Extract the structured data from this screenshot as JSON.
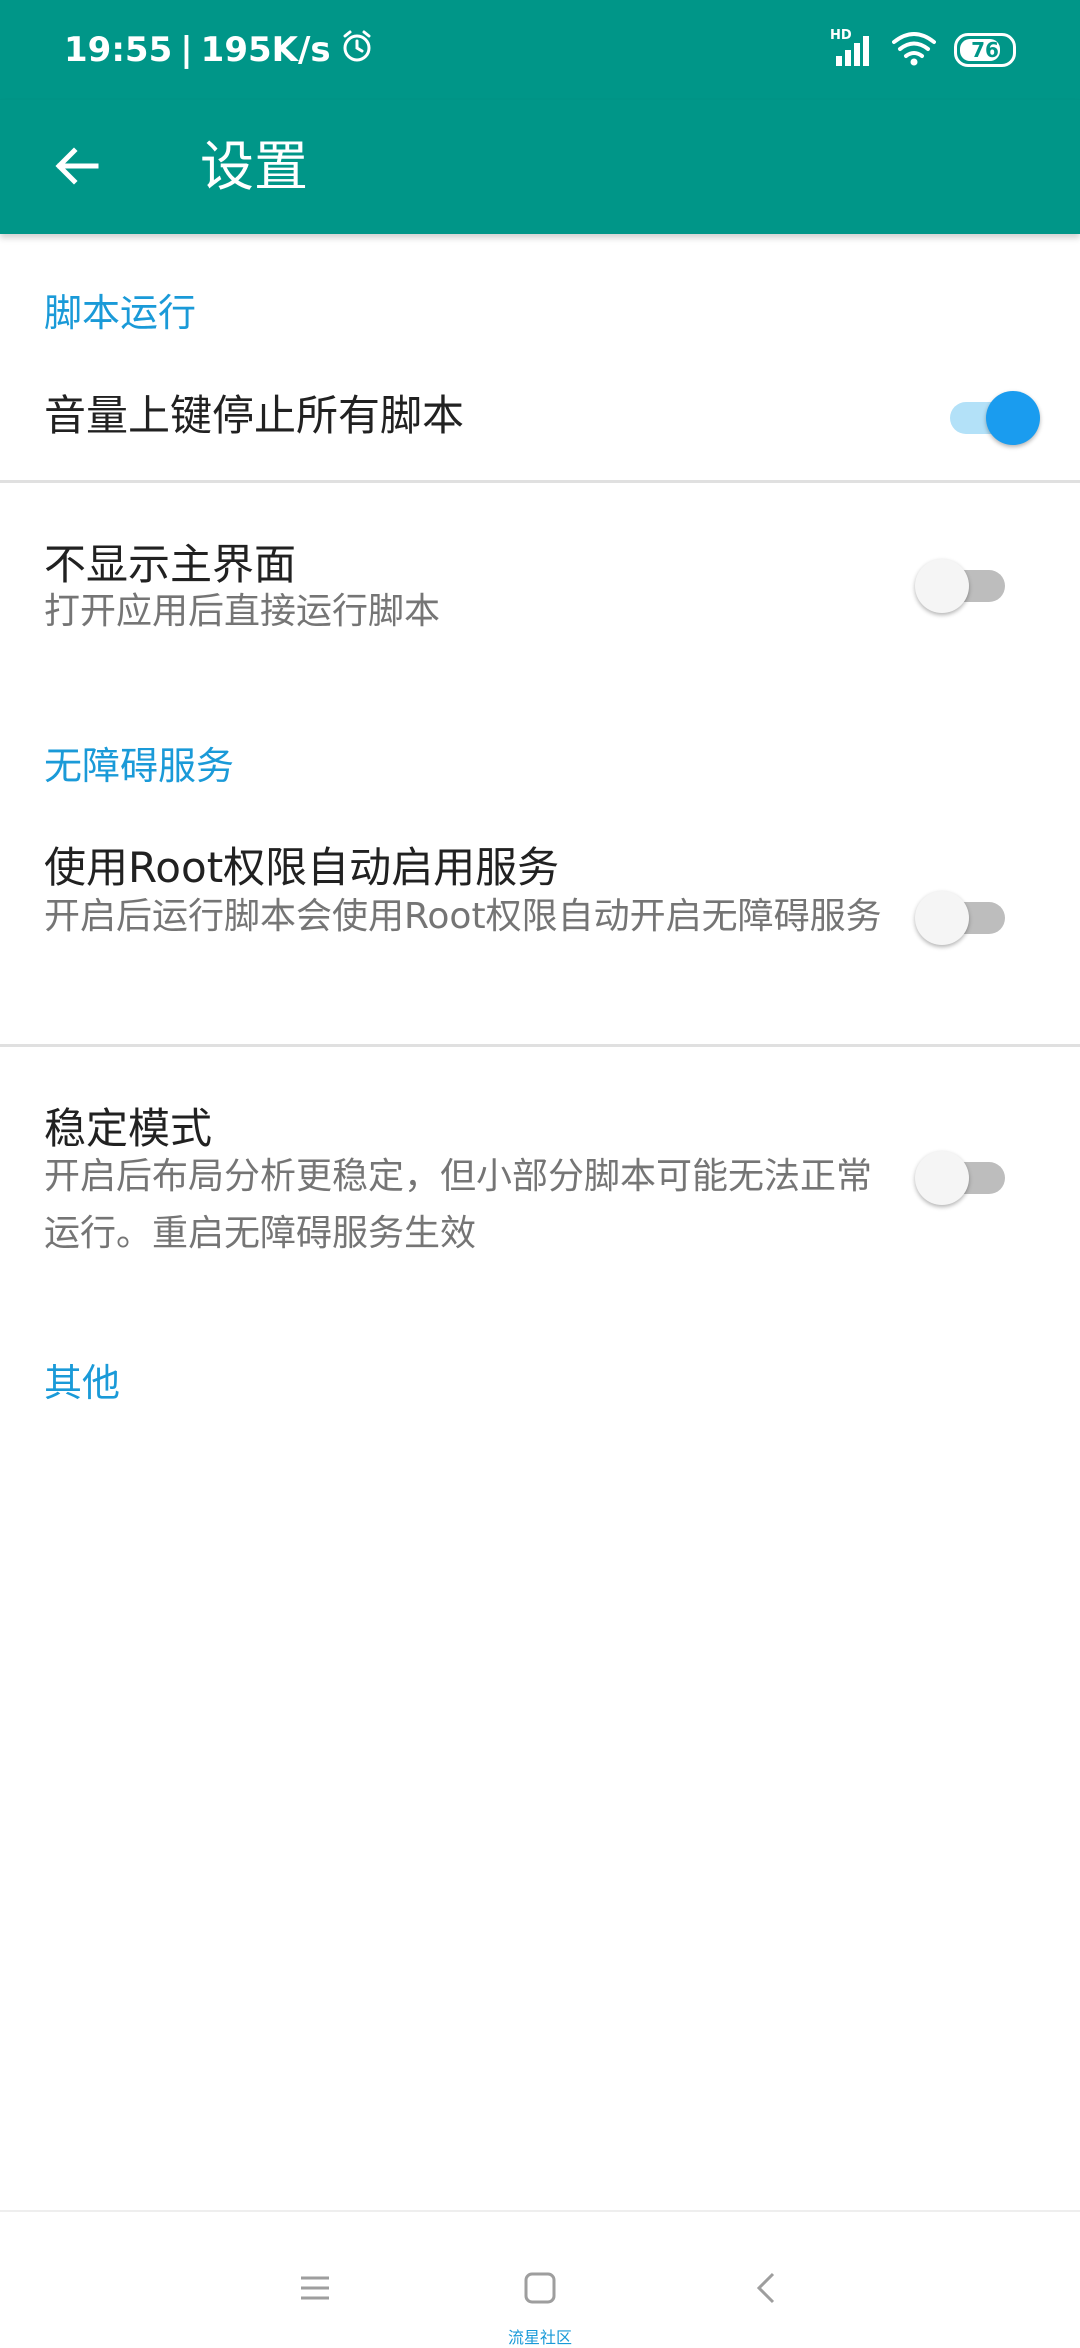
{
  "status_bar": {
    "time": "19:55",
    "separator": "|",
    "speed": "195K/s",
    "signal_label": "HD",
    "battery": "76"
  },
  "app_bar": {
    "title": "设置"
  },
  "sections": {
    "script_run": "脚本运行",
    "accessibility": "无障碍服务",
    "other": "其他"
  },
  "settings": {
    "volume_stop": {
      "title": "音量上键停止所有脚本",
      "enabled": true
    },
    "hide_main": {
      "title": "不显示主界面",
      "subtitle": "打开应用后直接运行脚本",
      "enabled": false
    },
    "root_service": {
      "title": "使用Root权限自动启用服务",
      "subtitle": "开启后运行脚本会使用Root权限自动开启无障碍服务",
      "enabled": false
    },
    "stable_mode": {
      "title": "稳定模式",
      "subtitle": "开启后布局分析更稳定，但小部分脚本可能无法正常运行。重启无障碍服务生效",
      "enabled": false
    }
  },
  "watermark": "流星社区",
  "colors": {
    "primary": "#009688",
    "accent": "#1a9cef",
    "section_text": "#1a9ad8"
  },
  "icons": {
    "back": "arrow-left-icon",
    "alarm": "alarm-icon",
    "signal": "signal-icon",
    "wifi": "wifi-icon",
    "battery": "battery-icon",
    "menu": "menu-icon",
    "home": "home-icon",
    "nav_back": "chevron-left-icon"
  }
}
